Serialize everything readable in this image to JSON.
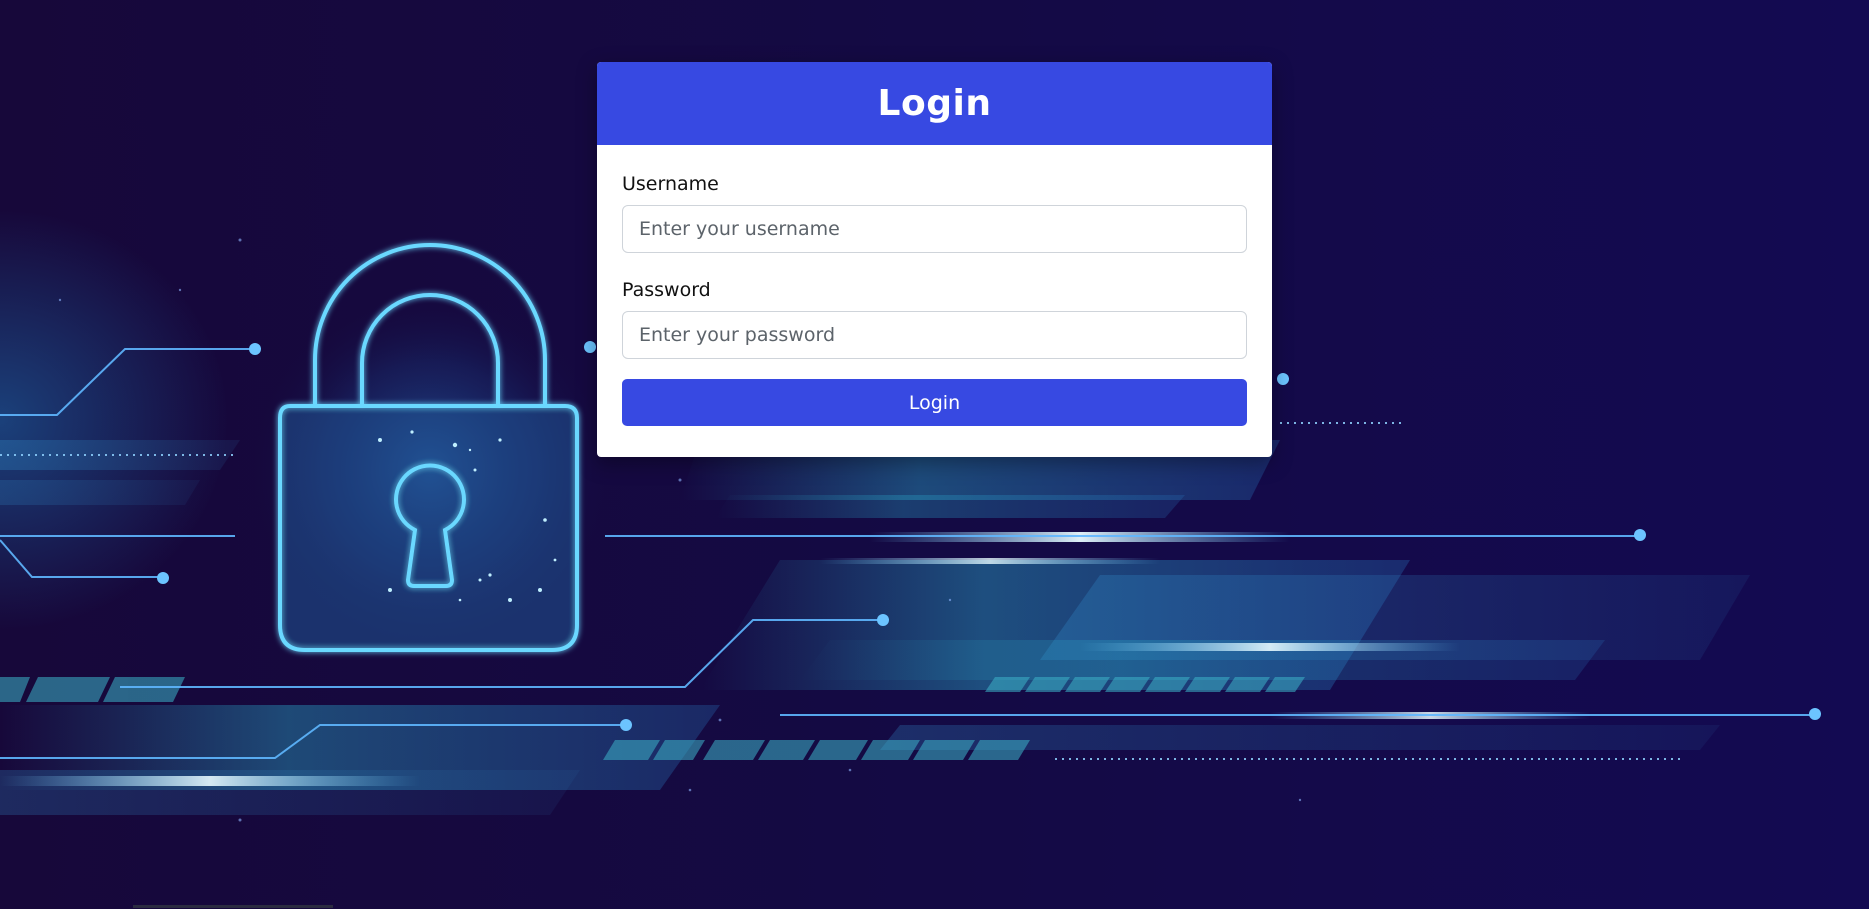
{
  "page": {
    "background_color": "#140a3d",
    "accent_color": "#3749e2"
  },
  "login_card": {
    "title": "Login",
    "username": {
      "label": "Username",
      "value": "",
      "placeholder": "Enter your username"
    },
    "password": {
      "label": "Password",
      "value": "",
      "placeholder": "Enter your password"
    },
    "submit_label": "Login"
  },
  "background_art": {
    "icon": "padlock-icon",
    "theme": "cybersecurity-circuit"
  }
}
